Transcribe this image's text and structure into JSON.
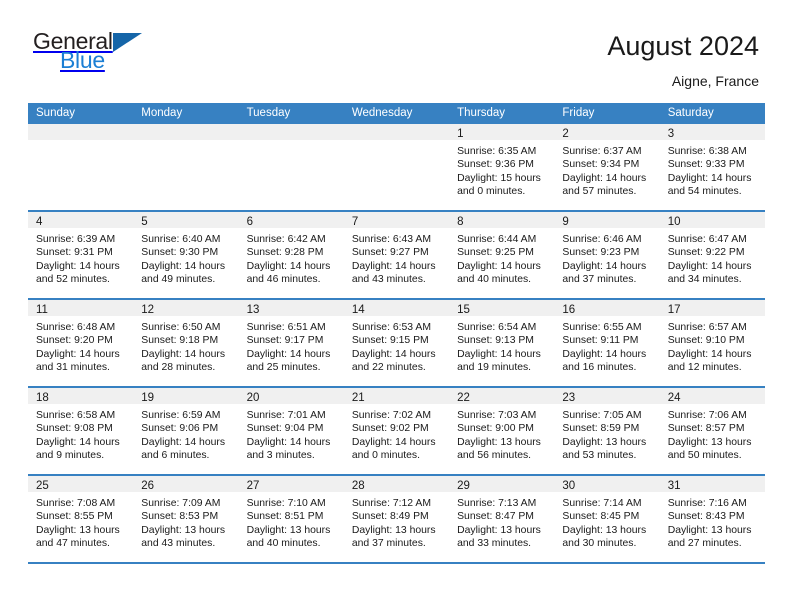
{
  "brand": {
    "word1": "General",
    "word2": "Blue",
    "flag_icon": "triangle-flag-icon",
    "color_dark": "#231f20",
    "color_blue": "#1b7fd4"
  },
  "header": {
    "title": "August 2024",
    "subtitle": "Aigne, France"
  },
  "theme": {
    "header_blue": "#3781c2",
    "daynum_band": "#f0f0f0",
    "text": "#1a1a1a"
  },
  "calendar": {
    "weekday_headers": [
      "Sunday",
      "Monday",
      "Tuesday",
      "Wednesday",
      "Thursday",
      "Friday",
      "Saturday"
    ],
    "weeks": [
      [
        {
          "day": "",
          "sunrise": "",
          "sunset": "",
          "daylight1": "",
          "daylight2": ""
        },
        {
          "day": "",
          "sunrise": "",
          "sunset": "",
          "daylight1": "",
          "daylight2": ""
        },
        {
          "day": "",
          "sunrise": "",
          "sunset": "",
          "daylight1": "",
          "daylight2": ""
        },
        {
          "day": "",
          "sunrise": "",
          "sunset": "",
          "daylight1": "",
          "daylight2": ""
        },
        {
          "day": "1",
          "sunrise": "Sunrise: 6:35 AM",
          "sunset": "Sunset: 9:36 PM",
          "daylight1": "Daylight: 15 hours",
          "daylight2": "and 0 minutes."
        },
        {
          "day": "2",
          "sunrise": "Sunrise: 6:37 AM",
          "sunset": "Sunset: 9:34 PM",
          "daylight1": "Daylight: 14 hours",
          "daylight2": "and 57 minutes."
        },
        {
          "day": "3",
          "sunrise": "Sunrise: 6:38 AM",
          "sunset": "Sunset: 9:33 PM",
          "daylight1": "Daylight: 14 hours",
          "daylight2": "and 54 minutes."
        }
      ],
      [
        {
          "day": "4",
          "sunrise": "Sunrise: 6:39 AM",
          "sunset": "Sunset: 9:31 PM",
          "daylight1": "Daylight: 14 hours",
          "daylight2": "and 52 minutes."
        },
        {
          "day": "5",
          "sunrise": "Sunrise: 6:40 AM",
          "sunset": "Sunset: 9:30 PM",
          "daylight1": "Daylight: 14 hours",
          "daylight2": "and 49 minutes."
        },
        {
          "day": "6",
          "sunrise": "Sunrise: 6:42 AM",
          "sunset": "Sunset: 9:28 PM",
          "daylight1": "Daylight: 14 hours",
          "daylight2": "and 46 minutes."
        },
        {
          "day": "7",
          "sunrise": "Sunrise: 6:43 AM",
          "sunset": "Sunset: 9:27 PM",
          "daylight1": "Daylight: 14 hours",
          "daylight2": "and 43 minutes."
        },
        {
          "day": "8",
          "sunrise": "Sunrise: 6:44 AM",
          "sunset": "Sunset: 9:25 PM",
          "daylight1": "Daylight: 14 hours",
          "daylight2": "and 40 minutes."
        },
        {
          "day": "9",
          "sunrise": "Sunrise: 6:46 AM",
          "sunset": "Sunset: 9:23 PM",
          "daylight1": "Daylight: 14 hours",
          "daylight2": "and 37 minutes."
        },
        {
          "day": "10",
          "sunrise": "Sunrise: 6:47 AM",
          "sunset": "Sunset: 9:22 PM",
          "daylight1": "Daylight: 14 hours",
          "daylight2": "and 34 minutes."
        }
      ],
      [
        {
          "day": "11",
          "sunrise": "Sunrise: 6:48 AM",
          "sunset": "Sunset: 9:20 PM",
          "daylight1": "Daylight: 14 hours",
          "daylight2": "and 31 minutes."
        },
        {
          "day": "12",
          "sunrise": "Sunrise: 6:50 AM",
          "sunset": "Sunset: 9:18 PM",
          "daylight1": "Daylight: 14 hours",
          "daylight2": "and 28 minutes."
        },
        {
          "day": "13",
          "sunrise": "Sunrise: 6:51 AM",
          "sunset": "Sunset: 9:17 PM",
          "daylight1": "Daylight: 14 hours",
          "daylight2": "and 25 minutes."
        },
        {
          "day": "14",
          "sunrise": "Sunrise: 6:53 AM",
          "sunset": "Sunset: 9:15 PM",
          "daylight1": "Daylight: 14 hours",
          "daylight2": "and 22 minutes."
        },
        {
          "day": "15",
          "sunrise": "Sunrise: 6:54 AM",
          "sunset": "Sunset: 9:13 PM",
          "daylight1": "Daylight: 14 hours",
          "daylight2": "and 19 minutes."
        },
        {
          "day": "16",
          "sunrise": "Sunrise: 6:55 AM",
          "sunset": "Sunset: 9:11 PM",
          "daylight1": "Daylight: 14 hours",
          "daylight2": "and 16 minutes."
        },
        {
          "day": "17",
          "sunrise": "Sunrise: 6:57 AM",
          "sunset": "Sunset: 9:10 PM",
          "daylight1": "Daylight: 14 hours",
          "daylight2": "and 12 minutes."
        }
      ],
      [
        {
          "day": "18",
          "sunrise": "Sunrise: 6:58 AM",
          "sunset": "Sunset: 9:08 PM",
          "daylight1": "Daylight: 14 hours",
          "daylight2": "and 9 minutes."
        },
        {
          "day": "19",
          "sunrise": "Sunrise: 6:59 AM",
          "sunset": "Sunset: 9:06 PM",
          "daylight1": "Daylight: 14 hours",
          "daylight2": "and 6 minutes."
        },
        {
          "day": "20",
          "sunrise": "Sunrise: 7:01 AM",
          "sunset": "Sunset: 9:04 PM",
          "daylight1": "Daylight: 14 hours",
          "daylight2": "and 3 minutes."
        },
        {
          "day": "21",
          "sunrise": "Sunrise: 7:02 AM",
          "sunset": "Sunset: 9:02 PM",
          "daylight1": "Daylight: 14 hours",
          "daylight2": "and 0 minutes."
        },
        {
          "day": "22",
          "sunrise": "Sunrise: 7:03 AM",
          "sunset": "Sunset: 9:00 PM",
          "daylight1": "Daylight: 13 hours",
          "daylight2": "and 56 minutes."
        },
        {
          "day": "23",
          "sunrise": "Sunrise: 7:05 AM",
          "sunset": "Sunset: 8:59 PM",
          "daylight1": "Daylight: 13 hours",
          "daylight2": "and 53 minutes."
        },
        {
          "day": "24",
          "sunrise": "Sunrise: 7:06 AM",
          "sunset": "Sunset: 8:57 PM",
          "daylight1": "Daylight: 13 hours",
          "daylight2": "and 50 minutes."
        }
      ],
      [
        {
          "day": "25",
          "sunrise": "Sunrise: 7:08 AM",
          "sunset": "Sunset: 8:55 PM",
          "daylight1": "Daylight: 13 hours",
          "daylight2": "and 47 minutes."
        },
        {
          "day": "26",
          "sunrise": "Sunrise: 7:09 AM",
          "sunset": "Sunset: 8:53 PM",
          "daylight1": "Daylight: 13 hours",
          "daylight2": "and 43 minutes."
        },
        {
          "day": "27",
          "sunrise": "Sunrise: 7:10 AM",
          "sunset": "Sunset: 8:51 PM",
          "daylight1": "Daylight: 13 hours",
          "daylight2": "and 40 minutes."
        },
        {
          "day": "28",
          "sunrise": "Sunrise: 7:12 AM",
          "sunset": "Sunset: 8:49 PM",
          "daylight1": "Daylight: 13 hours",
          "daylight2": "and 37 minutes."
        },
        {
          "day": "29",
          "sunrise": "Sunrise: 7:13 AM",
          "sunset": "Sunset: 8:47 PM",
          "daylight1": "Daylight: 13 hours",
          "daylight2": "and 33 minutes."
        },
        {
          "day": "30",
          "sunrise": "Sunrise: 7:14 AM",
          "sunset": "Sunset: 8:45 PM",
          "daylight1": "Daylight: 13 hours",
          "daylight2": "and 30 minutes."
        },
        {
          "day": "31",
          "sunrise": "Sunrise: 7:16 AM",
          "sunset": "Sunset: 8:43 PM",
          "daylight1": "Daylight: 13 hours",
          "daylight2": "and 27 minutes."
        }
      ]
    ]
  }
}
